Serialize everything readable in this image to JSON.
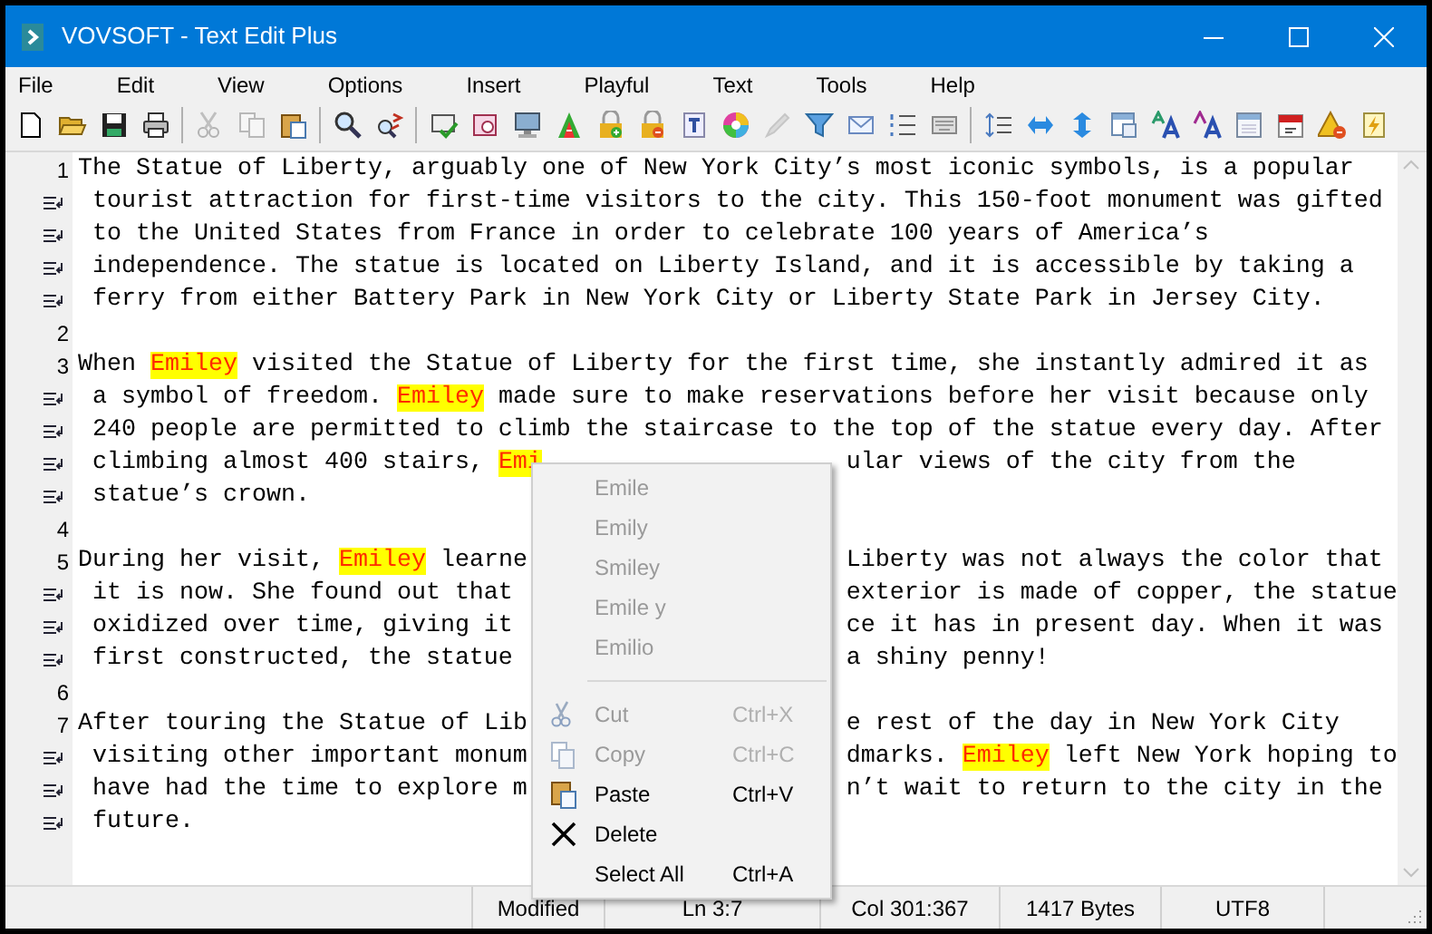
{
  "window": {
    "title": "VOVSOFT - Text Edit Plus"
  },
  "menu_bar": [
    "File",
    "Edit",
    "View",
    "Options",
    "Insert",
    "Playful",
    "Text",
    "Tools",
    "Help"
  ],
  "toolbar": [
    {
      "kind": "new"
    },
    {
      "kind": "open"
    },
    {
      "kind": "save"
    },
    {
      "kind": "print"
    },
    {
      "kind": "sep"
    },
    {
      "kind": "cut",
      "disabled": true
    },
    {
      "kind": "copy",
      "disabled": true
    },
    {
      "kind": "paste",
      "disabled": false
    },
    {
      "kind": "sep"
    },
    {
      "kind": "find"
    },
    {
      "kind": "replace"
    },
    {
      "kind": "sep"
    },
    {
      "kind": "spell"
    },
    {
      "kind": "preview"
    },
    {
      "kind": "monitor"
    },
    {
      "kind": "fontcolor"
    },
    {
      "kind": "lockplus"
    },
    {
      "kind": "lockminus"
    },
    {
      "kind": "textt"
    },
    {
      "kind": "wheel"
    },
    {
      "kind": "pen",
      "disabled": true
    },
    {
      "kind": "filter"
    },
    {
      "kind": "mail"
    },
    {
      "kind": "list"
    },
    {
      "kind": "keyboard"
    },
    {
      "kind": "sep"
    },
    {
      "kind": "spacing"
    },
    {
      "kind": "hарrows"
    },
    {
      "kind": "varrows"
    },
    {
      "kind": "window"
    },
    {
      "kind": "fontab"
    },
    {
      "kind": "fonta"
    },
    {
      "kind": "panel"
    },
    {
      "kind": "calendar"
    },
    {
      "kind": "warning"
    },
    {
      "kind": "note"
    }
  ],
  "editor": {
    "lines": [
      {
        "kind": "numbered",
        "number": "1",
        "text": [
          {
            "text": "The Statue of Liberty, arguably one of New York City’s most iconic symbols, is a popular"
          }
        ]
      },
      {
        "kind": "wrapped",
        "text": [
          {
            "text": "tourist attraction for first-time visitors to the city. This 150-foot monument was gifted"
          }
        ]
      },
      {
        "kind": "wrapped",
        "text": [
          {
            "text": "to the United States from France in order to celebrate 100 years of America’s"
          }
        ]
      },
      {
        "kind": "wrapped",
        "text": [
          {
            "text": "independence. The statue is located on Liberty Island, and it is accessible by taking a"
          }
        ]
      },
      {
        "kind": "wrapped",
        "text": [
          {
            "text": "ferry from either Battery Park in New York City or Liberty State Park in Jersey City."
          }
        ]
      },
      {
        "kind": "numbered",
        "number": "2"
      },
      {
        "kind": "numbered",
        "number": "3",
        "text": [
          {
            "text": "When "
          },
          {
            "text": "Emiley",
            "highlight": true
          },
          {
            "text": " visited the Statue of Liberty for the first time, she instantly admired it as"
          }
        ]
      },
      {
        "kind": "wrapped",
        "text": [
          {
            "text": "a symbol of freedom. "
          },
          {
            "text": "Emiley",
            "highlight": true
          },
          {
            "text": " made sure to make reservations before her visit because only"
          }
        ]
      },
      {
        "kind": "wrapped",
        "text": [
          {
            "text": "240 people are permitted to climb the staircase to the top of the statue every day. After"
          }
        ]
      },
      {
        "kind": "wrapped",
        "text": [
          {
            "text": "climbing almost 400 stairs, "
          },
          {
            "text": "Emi",
            "highlight": true
          }
        ],
        "right": [
          {
            "text": "ular views of the city from the"
          }
        ]
      },
      {
        "kind": "wrapped",
        "text": [
          {
            "text": "statue’s crown."
          }
        ]
      },
      {
        "kind": "numbered",
        "number": "4"
      },
      {
        "kind": "numbered",
        "number": "5",
        "text": [
          {
            "text": "During her visit, "
          },
          {
            "text": "Emiley",
            "highlight": true
          },
          {
            "text": " learne"
          }
        ],
        "right": [
          {
            "text": "Liberty was not always the color that"
          }
        ]
      },
      {
        "kind": "wrapped",
        "text": [
          {
            "text": "it is now. She found out that"
          }
        ],
        "right": [
          {
            "text": "exterior is made of copper, the statue"
          }
        ]
      },
      {
        "kind": "wrapped",
        "text": [
          {
            "text": "oxidized over time, giving it"
          }
        ],
        "right": [
          {
            "text": "ce it has in present day. When it was"
          }
        ]
      },
      {
        "kind": "wrapped",
        "text": [
          {
            "text": "first constructed, the statue"
          }
        ],
        "right": [
          {
            "text": "a shiny penny!"
          }
        ]
      },
      {
        "kind": "numbered",
        "number": "6"
      },
      {
        "kind": "numbered",
        "number": "7",
        "text": [
          {
            "text": "After touring the Statue of Lib"
          }
        ],
        "right": [
          {
            "text": "e rest of the day in New York City"
          }
        ]
      },
      {
        "kind": "wrapped",
        "text": [
          {
            "text": "visiting other important monum"
          }
        ],
        "right": [
          {
            "text": "dmarks. "
          },
          {
            "text": "Emiley",
            "highlight": true
          },
          {
            "text": " left New York hoping to"
          }
        ]
      },
      {
        "kind": "wrapped",
        "text": [
          {
            "text": "have had the time to explore m"
          }
        ],
        "right": [
          {
            "text": "n’t wait to return to the city in the"
          }
        ]
      },
      {
        "kind": "wrapped",
        "text": [
          {
            "text": "future."
          }
        ]
      }
    ]
  },
  "context_menu": [
    {
      "kind": "suggestion",
      "label": "Emile"
    },
    {
      "kind": "suggestion",
      "label": "Emily"
    },
    {
      "kind": "suggestion",
      "label": "Smiley"
    },
    {
      "kind": "suggestion",
      "label": "Emile y"
    },
    {
      "kind": "suggestion",
      "label": "Emilio"
    },
    {
      "kind": "separator"
    },
    {
      "kind": "command",
      "label": "Cut",
      "shortcut": "Ctrl+X",
      "disabled": true
    },
    {
      "kind": "command",
      "label": "Copy",
      "shortcut": "Ctrl+C",
      "disabled": true
    },
    {
      "kind": "command",
      "label": "Paste",
      "shortcut": "Ctrl+V",
      "disabled": false
    },
    {
      "kind": "command",
      "label": "Delete",
      "disabled": false
    },
    {
      "kind": "command",
      "label": "Select All",
      "shortcut": "Ctrl+A",
      "disabled": false
    }
  ],
  "status_bar": [
    "Modified",
    "Ln 3:7",
    "Col 301:367",
    "1417 Bytes",
    "UTF8"
  ]
}
